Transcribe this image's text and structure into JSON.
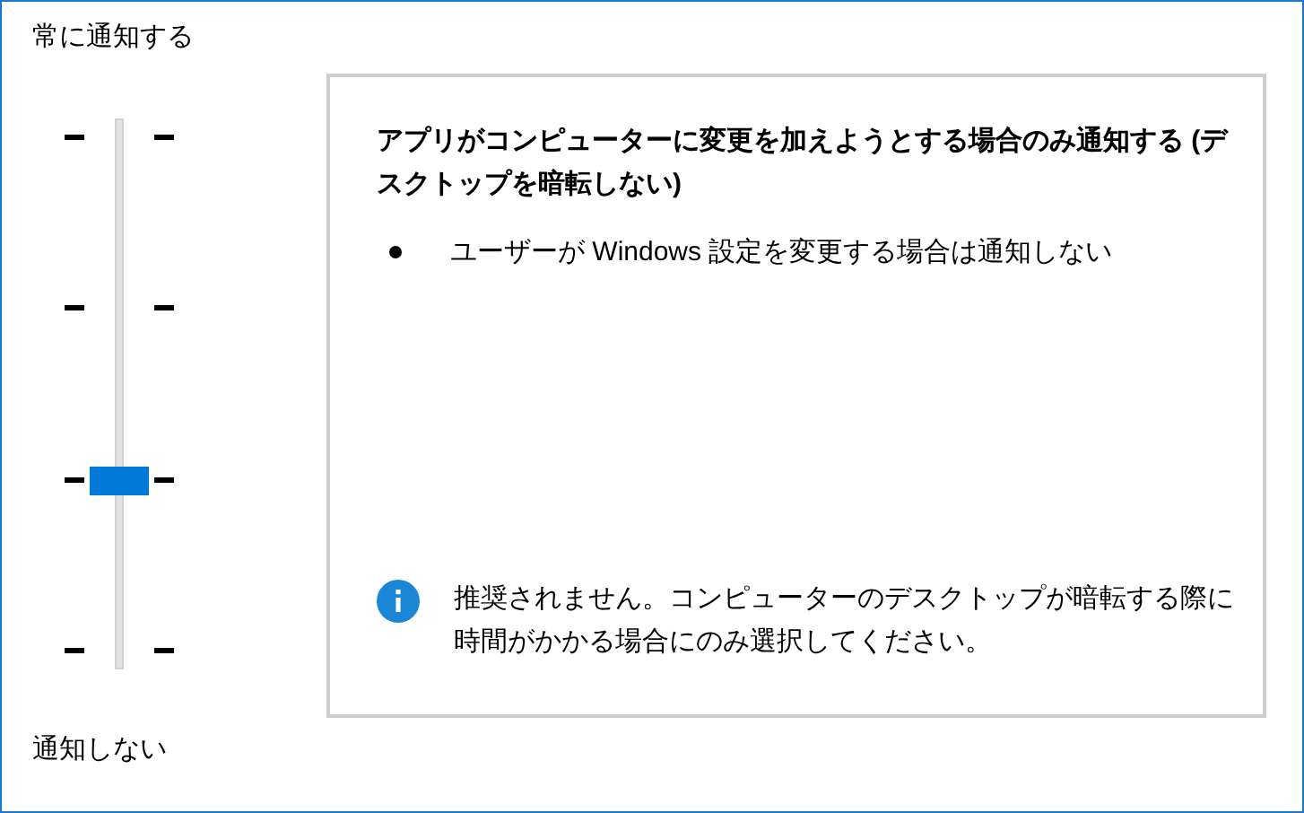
{
  "labels": {
    "top": "常に通知する",
    "bottom": "通知しない"
  },
  "slider": {
    "level": 0.3333
  },
  "description": {
    "title": "アプリがコンピューターに変更を加えようとする場合のみ通知する (デスクトップを暗転しない)",
    "bullets": [
      "ユーザーが Windows 設定を変更する場合は通知しない"
    ],
    "note": "推奨されません。コンピューターのデスクトップが暗転する際に時間がかかる場合にのみ選択してください。"
  }
}
